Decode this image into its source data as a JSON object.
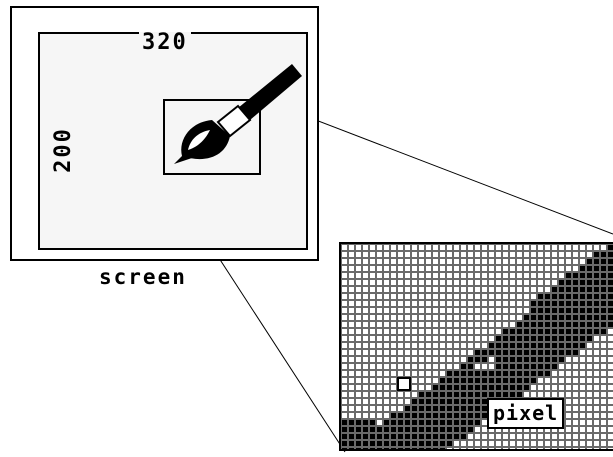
{
  "labels": {
    "width": "320",
    "height": "200",
    "screen": "screen",
    "pixel": "pixel"
  },
  "icons": {
    "brush": "paintbrush-icon"
  },
  "colors": {
    "ink": "#000000",
    "paper": "#ffffff"
  }
}
